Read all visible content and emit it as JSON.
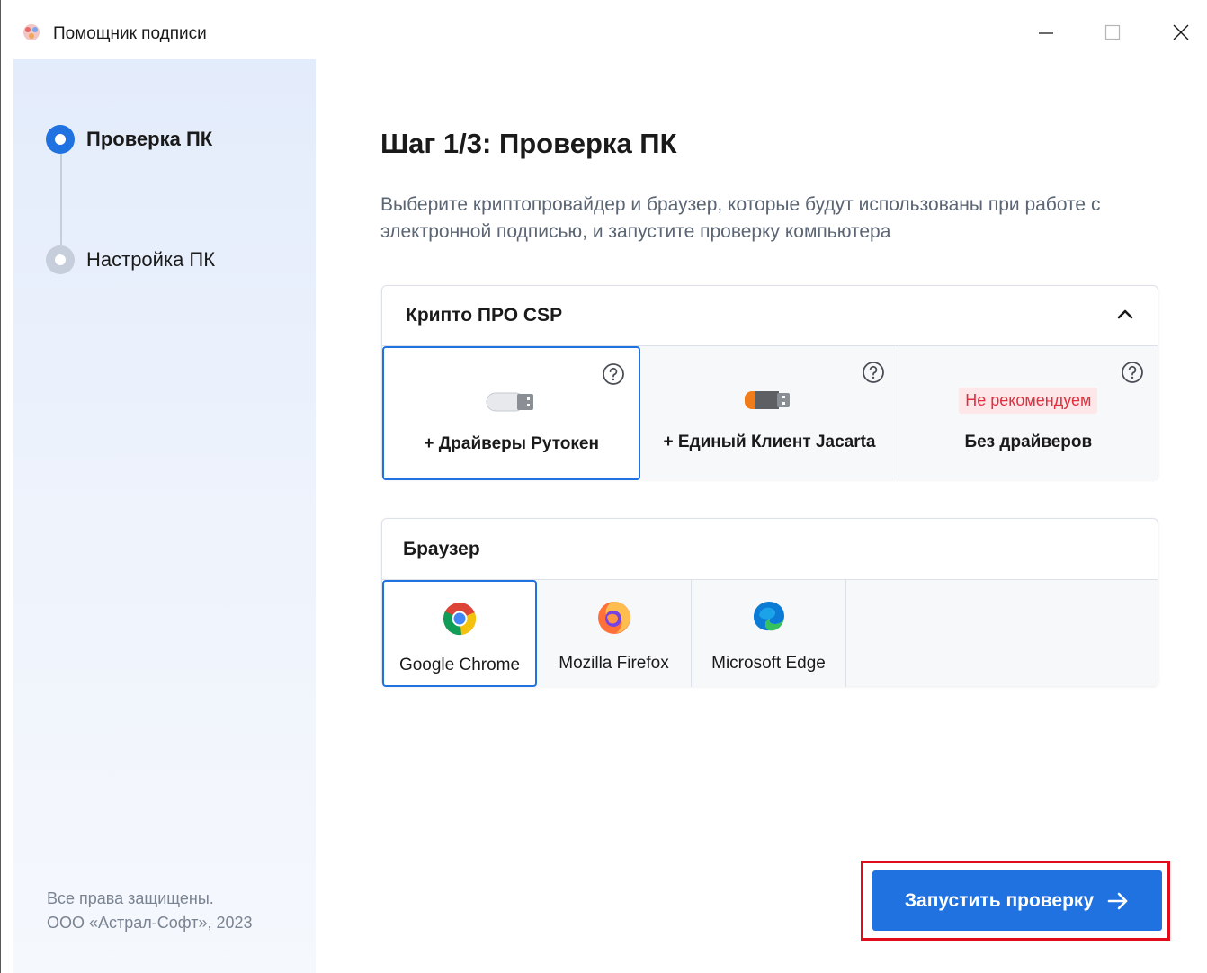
{
  "window": {
    "title": "Помощник подписи",
    "controls": {
      "minimize_icon": "minimize-icon",
      "maximize_icon": "maximize-icon",
      "close_icon": "close-icon"
    }
  },
  "sidebar": {
    "steps": [
      {
        "label": "Проверка ПК",
        "state": "active"
      },
      {
        "label": "Настройка ПК",
        "state": "inactive"
      }
    ],
    "footer": {
      "line1": "Все права защищены.",
      "line2": "ООО «Астрал-Софт», 2023"
    }
  },
  "main": {
    "heading": "Шаг 1/3: Проверка ПК",
    "description": "Выберите криптопровайдер и браузер, которые будут использованы при работе с электронной подписью, и запустите проверку компьютера",
    "crypto": {
      "title": "Крипто ПРО CSP",
      "expanded": true,
      "options": [
        {
          "label": "+ Драйверы Рутокен",
          "icon": "usb-token-white-icon",
          "selected": true
        },
        {
          "label": "+ Единый Клиент Jacarta",
          "icon": "usb-token-orange-icon",
          "selected": false
        },
        {
          "label": "Без драйверов",
          "badge": "Не рекомендуем",
          "selected": false
        }
      ]
    },
    "browser": {
      "title": "Браузер",
      "options": [
        {
          "label": "Google Chrome",
          "icon": "chrome-icon",
          "selected": true
        },
        {
          "label": "Mozilla Firefox",
          "icon": "firefox-icon",
          "selected": false
        },
        {
          "label": "Microsoft Edge",
          "icon": "edge-icon",
          "selected": false
        }
      ]
    },
    "run_button": {
      "label": "Запустить проверку",
      "icon": "arrow-right-icon"
    }
  },
  "colors": {
    "accent": "#1f72e0",
    "badge_text": "#e02f3f",
    "badge_bg": "#fde7e9",
    "highlight": "#e20d1b"
  }
}
